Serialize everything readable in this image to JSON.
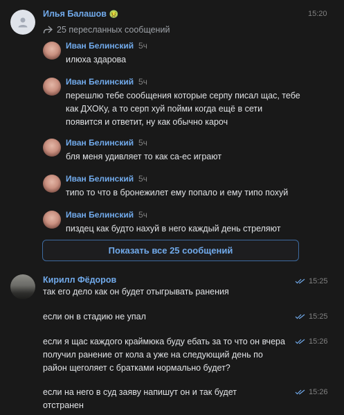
{
  "message1": {
    "author": "Илья Балашов",
    "author_emoji": "🤢",
    "time": "15:20",
    "forwarded_label": "25 пересланных сообщений",
    "forwarded": [
      {
        "author": "Иван Белинский",
        "ago": "5ч",
        "text": "илюха здарова"
      },
      {
        "author": "Иван Белинский",
        "ago": "5ч",
        "text": "перешлю тебе сообщения которые серпу писал щас, тебе как ДХОКу, а то серп хуй пойми когда ещё в сети появится и ответит, ну как обычно кароч"
      },
      {
        "author": "Иван Белинский",
        "ago": "5ч",
        "text": "бля меня удивляет то как са-ес играют"
      },
      {
        "author": "Иван Белинский",
        "ago": "5ч",
        "text": "типо то что в бронежилет ему попало и ему типо похуй"
      },
      {
        "author": "Иван Белинский",
        "ago": "5ч",
        "text": "пиздец как будто нахуй в него каждый день стреляют"
      }
    ],
    "show_all_label": "Показать все 25 сообщений"
  },
  "message2": {
    "author": "Кирилл Фёдоров",
    "items": [
      {
        "text": "так его дело как он будет отыгрывать ранения",
        "time": "15:25"
      },
      {
        "text": "если он в стадию не упал",
        "time": "15:25"
      },
      {
        "text": "если я щас каждого краймюка буду ебать за то что он вчера получил ранение от кола а уже на следующий день по район щеголяет с братками нормально будет?",
        "time": "15:26"
      },
      {
        "text": "если на него в суд заяву напишут он и так будет отстранен",
        "time": "15:26"
      }
    ]
  }
}
